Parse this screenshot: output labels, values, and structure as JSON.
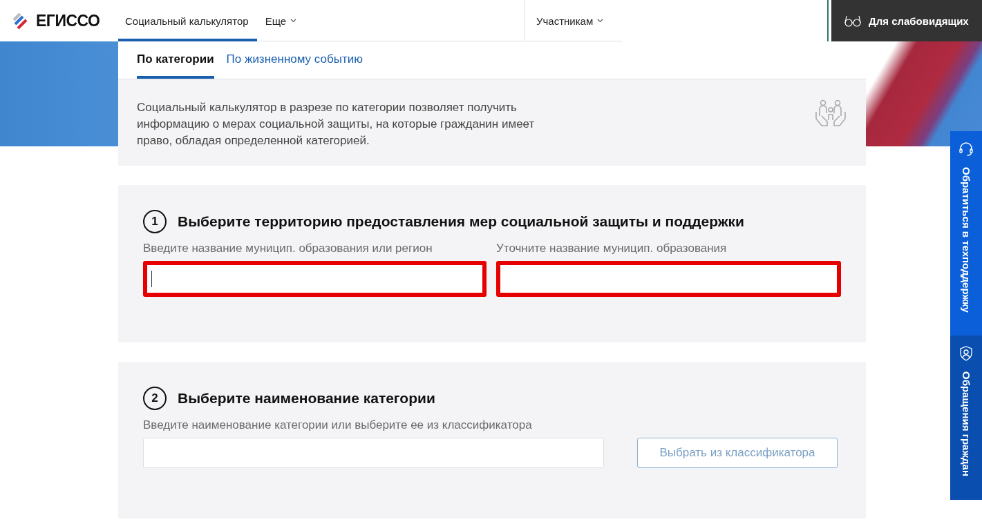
{
  "header": {
    "logo": "ЕГИССО",
    "nav": [
      {
        "label": "Социальный калькулятор",
        "selected": true,
        "dropdown": false
      },
      {
        "label": "Еще",
        "selected": false,
        "dropdown": true
      },
      {
        "label": "Участникам",
        "selected": false,
        "dropdown": true
      }
    ],
    "accessibility_button": "Для слабовидящих"
  },
  "tabs": [
    {
      "label": "По категории",
      "selected": true
    },
    {
      "label": "По жизненному событию",
      "selected": false
    }
  ],
  "description": "Социальный калькулятор в разрезе по категории позволяет получить информацию о мерах социальной защиты, на которые гражданин имеет право, обладая определенной категорией.",
  "steps": [
    {
      "number": "1",
      "title": "Выберите территорию предоставления мер социальной защиты и поддержки",
      "fields": [
        {
          "label": "Введите название муницип. образования или регион",
          "highlighted": true,
          "focused": true
        },
        {
          "label": "Уточните название муницип. образования",
          "highlighted": true,
          "focused": false
        }
      ]
    },
    {
      "number": "2",
      "title": "Выберите наименование категории",
      "fields": [
        {
          "label": "Введите наименование категории или выберите ее из классификатора",
          "highlighted": false,
          "focused": false
        }
      ],
      "button": "Выбрать из классификатора"
    }
  ],
  "side_tabs": [
    {
      "label": "Обратиться в техподдержку",
      "kind": "support"
    },
    {
      "label": "Обращения граждан",
      "kind": "appeals"
    }
  ]
}
